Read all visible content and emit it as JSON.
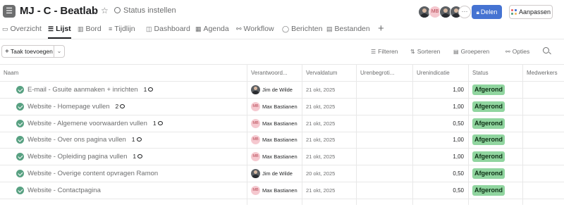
{
  "header": {
    "project_icon": "list-icon",
    "title": "MJ - C - Beatlab",
    "status_label": "Status instellen",
    "members": [
      {
        "type": "photo",
        "initials": ""
      },
      {
        "type": "initials",
        "initials": "MB"
      },
      {
        "type": "photo",
        "initials": ""
      },
      {
        "type": "photo",
        "initials": ""
      }
    ],
    "more_label": "···",
    "share_label": "Delen",
    "customize_label": "Aanpassen",
    "customize_colors": [
      "#f06a6a",
      "#4573d2",
      "#58a182",
      "#f1bd6c"
    ]
  },
  "tabs": [
    {
      "label": "Overzicht",
      "icon": "▭",
      "active": false
    },
    {
      "label": "Lijst",
      "icon": "☰",
      "active": true
    },
    {
      "label": "Bord",
      "icon": "▥",
      "active": false
    },
    {
      "label": "Tijdlijn",
      "icon": "≡",
      "active": false
    },
    {
      "label": "Dashboard",
      "icon": "◫",
      "active": false
    },
    {
      "label": "Agenda",
      "icon": "▦",
      "active": false
    },
    {
      "label": "Workflow",
      "icon": "⚯",
      "active": false
    },
    {
      "label": "Berichten",
      "icon": "◯",
      "active": false
    },
    {
      "label": "Bestanden",
      "icon": "▤",
      "active": false
    }
  ],
  "toolbar": {
    "add_task_label": "Taak toevoegen",
    "filters_label": "Filteren",
    "sort_label": "Sorteren",
    "group_label": "Groeperen",
    "options_label": "Opties"
  },
  "columns": [
    "Naam",
    "Verantwoord...",
    "Vervaldatum",
    "Urenbegroti...",
    "Urenindicatie",
    "Status",
    "Medwerkers"
  ],
  "rows": [
    {
      "name": "E-mail - Gsuite aanmaken + inrichten",
      "comments": "1",
      "assignee": "Jim de Wilde",
      "avatar": "photo",
      "initials": "",
      "due": "21 okt, 2025",
      "budget": "",
      "hours": "1,00",
      "status": "Afgerond"
    },
    {
      "name": "Website - Homepage vullen",
      "comments": "2",
      "assignee": "Max Bastianen",
      "avatar": "initials",
      "initials": "MB",
      "due": "21 okt, 2025",
      "budget": "",
      "hours": "1,00",
      "status": "Afgerond"
    },
    {
      "name": "Website - Algemene voorwaarden vullen",
      "comments": "1",
      "assignee": "Max Bastianen",
      "avatar": "initials",
      "initials": "MB",
      "due": "21 okt, 2025",
      "budget": "",
      "hours": "0,50",
      "status": "Afgerond"
    },
    {
      "name": "Website - Over ons pagina vullen",
      "comments": "1",
      "assignee": "Max Bastianen",
      "avatar": "initials",
      "initials": "MB",
      "due": "21 okt, 2025",
      "budget": "",
      "hours": "1,00",
      "status": "Afgerond"
    },
    {
      "name": "Website - Opleiding pagina vullen",
      "comments": "1",
      "assignee": "Max Bastianen",
      "avatar": "initials",
      "initials": "MB",
      "due": "21 okt, 2025",
      "budget": "",
      "hours": "1,00",
      "status": "Afgerond"
    },
    {
      "name": "Website - Overige content opvragen Ramon",
      "comments": "",
      "assignee": "Jim de Wilde",
      "avatar": "photo",
      "initials": "",
      "due": "20 okt, 2025",
      "budget": "",
      "hours": "0,50",
      "status": "Afgerond"
    },
    {
      "name": "Website - Contactpagina",
      "comments": "",
      "assignee": "Max Bastianen",
      "avatar": "initials",
      "initials": "MB",
      "due": "21 okt, 2025",
      "budget": "",
      "hours": "0,50",
      "status": "Afgerond"
    }
  ]
}
